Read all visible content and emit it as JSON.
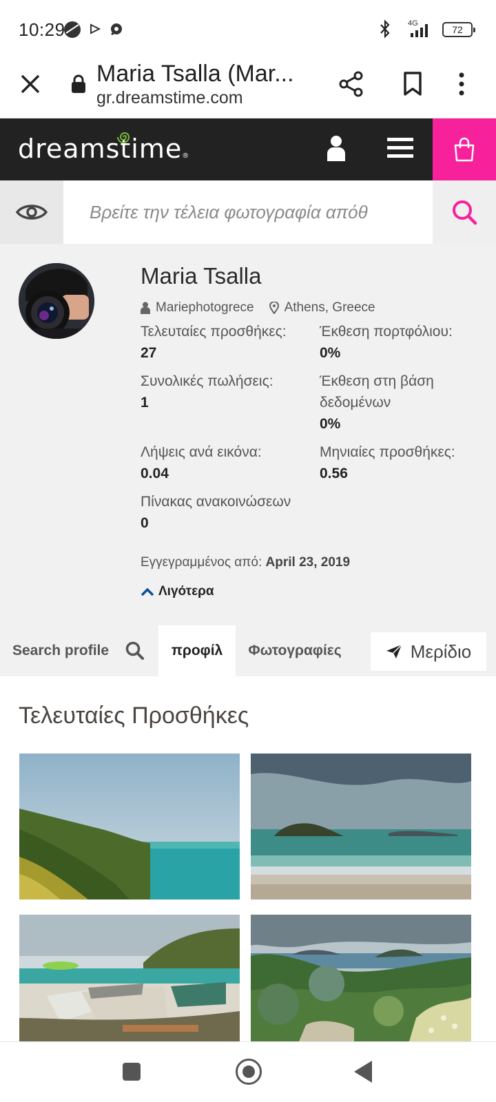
{
  "status_bar": {
    "time": "10:29",
    "network": "4G",
    "battery": "72",
    "icons": [
      "ball-icon",
      "play-icon",
      "chat-icon",
      "bluetooth-icon",
      "signal-icon",
      "battery-icon"
    ]
  },
  "browser": {
    "page_title": "Maria Tsalla (Mar...",
    "url": "gr.dreamstime.com",
    "icons": [
      "close-icon",
      "lock-icon",
      "share-icon",
      "bookmark-icon",
      "more-vert-icon"
    ]
  },
  "site": {
    "logo": "dreamstime",
    "logo_reg": "®",
    "accent": "#f7219c",
    "header_bg": "#222222"
  },
  "search": {
    "placeholder": "Βρείτε την τέλεια φωτογραφία απόθ"
  },
  "profile": {
    "name": "Maria Tsalla",
    "username": "Mariephotogrece",
    "location": "Athens, Greece",
    "stats": [
      {
        "label": "Τελευταίες προσθήκες:",
        "value": "27"
      },
      {
        "label": "Έκθεση πορτφόλιου:",
        "value": "0%"
      },
      {
        "label": "Συνολικές πωλήσεις:",
        "value": "1"
      },
      {
        "label": "Έκθεση στη βάση δεδομένων",
        "value": "0%"
      },
      {
        "label": "Λήψεις ανά εικόνα:",
        "value": "0.04"
      },
      {
        "label": "Μηνιαίες προσθήκες:",
        "value": "0.56"
      },
      {
        "label": "Πίνακας ανακοινώσεων",
        "value": "0"
      }
    ],
    "registered_label": "Εγγεγραμμένος από:",
    "registered_date": "April 23, 2019",
    "less_label": "Λιγότερα"
  },
  "tabs": {
    "search_profile": "Search profile",
    "profile": "προφίλ",
    "photos": "Φωτογραφίες",
    "share": "Μερίδιο"
  },
  "latest": {
    "title": "Τελευταίες Προσθήκες"
  }
}
